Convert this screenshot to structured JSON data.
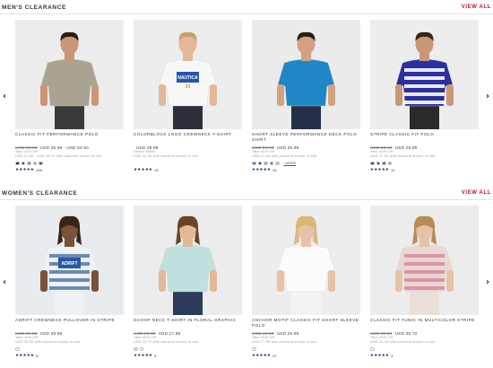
{
  "mens": {
    "title": "MEN'S CLEARANCE",
    "view_all": "VIEW ALL",
    "products": [
      {
        "name": "CLASSIC FIT PERFORMANCE POLO",
        "was": "USD 64.50",
        "now": "USD 35.99 - USD 64.50",
        "promo1": "Take 40% Off",
        "promo2": "USD 21.59 - USD 38.70 with discount shown in cart",
        "swatches": [
          "#1c1c1c",
          "#0b2c5a",
          "#8a8a8a",
          "#b8b3a5",
          "#3f5266"
        ],
        "more": "",
        "stars": "★★★★★",
        "reviews": "195",
        "photo": {
          "bg": "#ececec",
          "shirt": "#a9a492",
          "pants": "#3a3a3a",
          "skin": "#c99778",
          "hair": "#2b1e16"
        }
      },
      {
        "name": "COLORBLOCK LOGO CREWNECK T-SHIRT",
        "was": "",
        "now": "USD 39.99",
        "promo1": "Select Styles",
        "promo2": "USD 23.99 with discount shown in cart",
        "swatches": [],
        "more": "",
        "stars": "★★★★★",
        "reviews": "15",
        "photo": {
          "bg": "#ededed",
          "shirt": "#f7f7f7",
          "pants": "#2c2f3a",
          "skin": "#e2b898",
          "hair": "#c9a06a",
          "graphic": "NAUTICA",
          "graphic2": "83"
        }
      },
      {
        "name": "SHORT SLEEVE PERFORMANCE DECK POLO SHIRT",
        "was": "USD 59.50",
        "now": "USD 35.99",
        "promo1": "Take 40% Off",
        "promo2": "USD 21.59 with discount shown in cart",
        "swatches": [
          "#1e88c7",
          "#0b2c5a",
          "#7fb7d8",
          "#b02030",
          "#cccccc"
        ],
        "more": "+MORE",
        "stars": "★★★★★",
        "reviews": "34",
        "photo": {
          "bg": "#ebebeb",
          "shirt": "#1f87c6",
          "pants": "#243049",
          "skin": "#d2a183",
          "hair": "#2b2018"
        }
      },
      {
        "name": "STRIPE CLASSIC FIT POLO",
        "was": "USD 69.50",
        "now": "USD 29.99",
        "promo1": "Take 40% Off",
        "promo2": "USD 17.99 with discount shown in cart",
        "swatches": [
          "#2b2f8f",
          "#0b2c5a",
          "#3e6b8a",
          "#d98080"
        ],
        "more": "",
        "stars": "★★★★★",
        "reviews": "11",
        "photo": {
          "bg": "#ededed",
          "shirt": "#2b2fa0",
          "pants": "#2a2a2a",
          "skin": "#c99778",
          "hair": "#3b2416",
          "stripe": "#ffffff"
        }
      }
    ]
  },
  "womens": {
    "title": "WOMEN'S CLEARANCE",
    "view_all": "VIEW ALL",
    "products": [
      {
        "name": "ADRIFT CREWNECK PULLOVER IN STRIPE",
        "was": "USD 69.50",
        "now": "USD 39.99",
        "promo1": "Take 40% Off",
        "promo2": "USD 23.99 with discount shown in cart",
        "swatches": [
          "#ffffff"
        ],
        "more": "",
        "stars": "★★★★★",
        "reviews": "5",
        "photo": {
          "bg": "#e9ecef",
          "shirt": "#eef1f5",
          "pants": "#eef1f5",
          "skin": "#7a5139",
          "hair": "#3a2416",
          "stripe": "#5c7fa8",
          "graphic": "ADRIFT"
        }
      },
      {
        "name": "SCOOP NECK T-SHIRT IN FLORAL GRAPHIC",
        "was": "USD 29.50",
        "now": "USD 17.99",
        "promo1": "Take 40% Off",
        "promo2": "USD 10.79 with discount shown in cart",
        "swatches": [
          "#cfe3df",
          "#ffffff"
        ],
        "more": "",
        "stars": "★★★★★",
        "reviews": "9",
        "photo": {
          "bg": "#ececec",
          "shirt": "#bfe0dc",
          "pants": "#2a3b5c",
          "skin": "#e3b896",
          "hair": "#6b4326"
        }
      },
      {
        "name": "ANCHOR MOTIF CLASSIC FIT SHORT SLEEVE POLO",
        "was": "USD 49.50",
        "now": "USD 29.99",
        "promo1": "Take 40% Off",
        "promo2": "USD 17.99 with discount shown in cart",
        "swatches": [
          "#ffffff"
        ],
        "more": "",
        "stars": "★★★★★",
        "reviews": "27",
        "photo": {
          "bg": "#ededed",
          "shirt": "#fbfbfb",
          "pants": "#f3f3f3",
          "skin": "#e6c2a6",
          "hair": "#d9b77c"
        }
      },
      {
        "name": "CLASSIC FIT TUNIC IN MULTICOLOR STRIPE",
        "was": "USD 59.50",
        "now": "USD 35.70",
        "promo1": "Take 40% Off",
        "promo2": "USD 21.42 with discount shown in cart",
        "swatches": [
          "#ffffff"
        ],
        "more": "",
        "stars": "★★★★★",
        "reviews": "3",
        "photo": {
          "bg": "#ececec",
          "shirt": "#e8d7d4",
          "pants": "#e9e1d8",
          "skin": "#e6c2a6",
          "hair": "#b98a55",
          "stripe": "#d88fa1"
        }
      }
    ]
  },
  "icons": {
    "prev": "chevron-left-icon",
    "next": "chevron-right-icon"
  },
  "glyphs": {
    "prev": "‹",
    "next": "›"
  },
  "colors": {
    "accent": "#c8102e",
    "star": "#0b2c5a"
  }
}
